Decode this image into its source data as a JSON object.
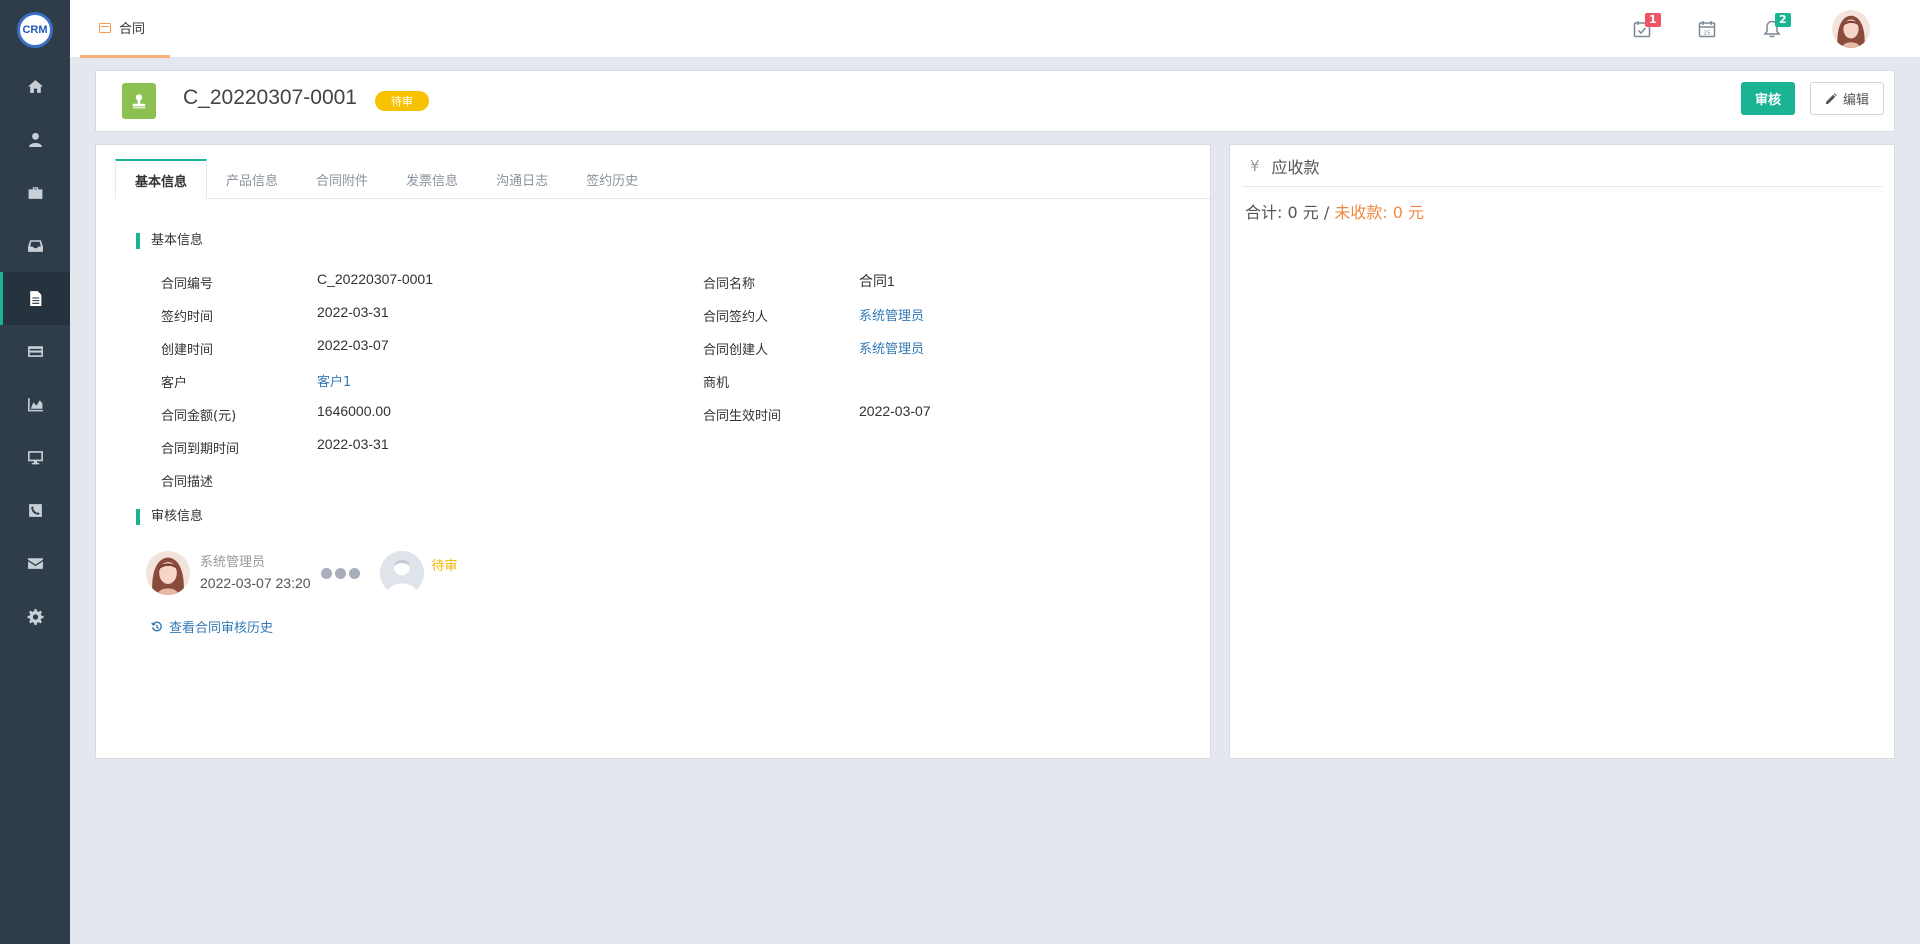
{
  "app": {
    "logo_text": "CRM"
  },
  "sidebar": {
    "items": [
      {
        "icon": "home-icon",
        "active": false
      },
      {
        "icon": "user-icon",
        "active": false
      },
      {
        "icon": "briefcase-icon",
        "active": false
      },
      {
        "icon": "inbox-icon",
        "active": false
      },
      {
        "icon": "document-icon",
        "active": true
      },
      {
        "icon": "credit-card-icon",
        "active": false
      },
      {
        "icon": "area-chart-icon",
        "active": false
      },
      {
        "icon": "desktop-icon",
        "active": false
      },
      {
        "icon": "phone-icon",
        "active": false
      },
      {
        "icon": "envelope-icon",
        "active": false
      },
      {
        "icon": "gear-icon",
        "active": false
      }
    ]
  },
  "topbar": {
    "tab_label": "合同",
    "tasks_badge": "1",
    "notifications_badge": "2"
  },
  "header": {
    "title": "C_20220307-0001",
    "status": "待审",
    "approve_label": "审核",
    "edit_label": "编辑"
  },
  "tabs": [
    "基本信息",
    "产品信息",
    "合同附件",
    "发票信息",
    "沟通日志",
    "签约历史"
  ],
  "basic": {
    "section_title": "基本信息",
    "left": [
      {
        "label": "合同编号",
        "value": "C_20220307-0001"
      },
      {
        "label": "签约时间",
        "value": "2022-03-31"
      },
      {
        "label": "创建时间",
        "value": "2022-03-07"
      },
      {
        "label": "客户",
        "value": "客户1"
      },
      {
        "label": "合同金额(元)",
        "value": "1646000.00"
      },
      {
        "label": "合同到期时间",
        "value": "2022-03-31"
      },
      {
        "label": "合同描述",
        "value": ""
      }
    ],
    "right": [
      {
        "label": "合同名称",
        "value": "合同1"
      },
      {
        "label": "合同签约人",
        "value": "系统管理员"
      },
      {
        "label": "合同创建人",
        "value": "系统管理员"
      },
      {
        "label": "商机",
        "value": ""
      },
      {
        "label": "合同生效时间",
        "value": "2022-03-07"
      }
    ]
  },
  "review": {
    "section_title": "审核信息",
    "approver_name": "系统管理员",
    "approver_time": "2022-03-07 23:20",
    "pending_status": "待审",
    "history_link": "查看合同审核历史"
  },
  "receivable": {
    "title": "应收款",
    "total_prefix": "合计: 0 元 / ",
    "unpaid": "未收款: 0 元"
  },
  "colors": {
    "accent": "#1ab394",
    "pending": "#f8c200",
    "warning": "#f08945",
    "link": "#337ab7"
  }
}
